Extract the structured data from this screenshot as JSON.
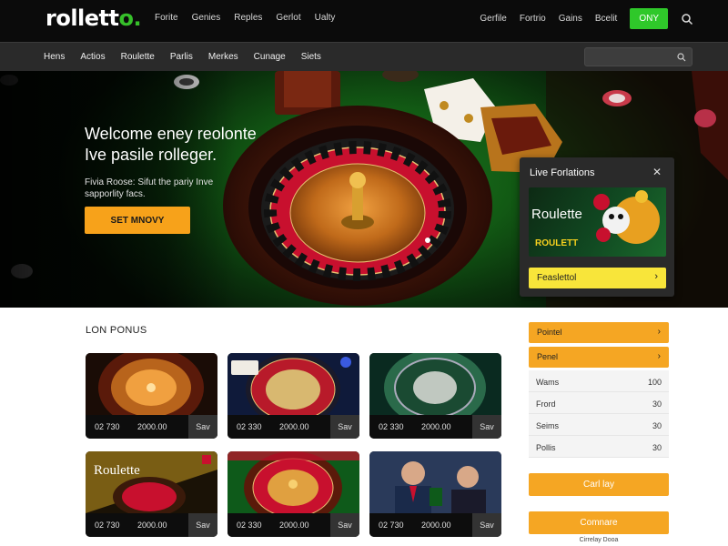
{
  "header": {
    "logo": {
      "main": "rollett",
      "accent": "o."
    },
    "nav": [
      "Forite",
      "Genies",
      "Reples",
      "Gerlot",
      "Ualty"
    ],
    "right_links": [
      "Gerfile",
      "Fortrio",
      "Gains",
      "Bcelit"
    ],
    "cta": "ONY"
  },
  "subnav": {
    "items": [
      "Hens",
      "Actios",
      "Roulette",
      "Parlis",
      "Merkes",
      "Cunage",
      "Siets"
    ],
    "search_placeholder": ""
  },
  "hero": {
    "title": "Welcome eney reolonte Ive pasile rolleger.",
    "subtitle": "Fivia Roose: Sifut the pariy Inve sapporlity facs.",
    "button": "SET MNOVY"
  },
  "live_popup": {
    "title": "Live Forlations",
    "close": "✕",
    "banner_title": "Roulette",
    "banner_sub": "ROULETT",
    "bar_label": "Feaslettol",
    "bar_chevron": "›"
  },
  "section": {
    "title": "LON PONUS",
    "cards": [
      {
        "a": "02 730",
        "b": "2000.00",
        "c": "Sav"
      },
      {
        "a": "02 330",
        "b": "2000.00",
        "c": "Sav"
      },
      {
        "a": "02 330",
        "b": "2000.00",
        "c": "Sav"
      },
      {
        "a": "02 730",
        "b": "2000.00",
        "c": "Sav",
        "overlay": "Roulette"
      },
      {
        "a": "02 330",
        "b": "2000.00",
        "c": "Sav"
      },
      {
        "a": "02 730",
        "b": "2000.00",
        "c": "Sav"
      }
    ]
  },
  "sidebar": {
    "btn1": "Pointel",
    "btn2": "Penel",
    "chevron": "›",
    "rows": [
      {
        "k": "Wams",
        "v": "100"
      },
      {
        "k": "Frord",
        "v": "30"
      },
      {
        "k": "Seims",
        "v": "30"
      },
      {
        "k": "Pollis",
        "v": "30"
      }
    ],
    "cta1": "Carl lay",
    "cta2": "Comnare",
    "footer": "Cirrelay Dooa"
  },
  "colors": {
    "topbar": "#0b0b0b",
    "subnav": "#2a2a2a",
    "green_cta": "#2fc82a",
    "orange": "#f5a623",
    "yellow": "#f8e53a"
  }
}
